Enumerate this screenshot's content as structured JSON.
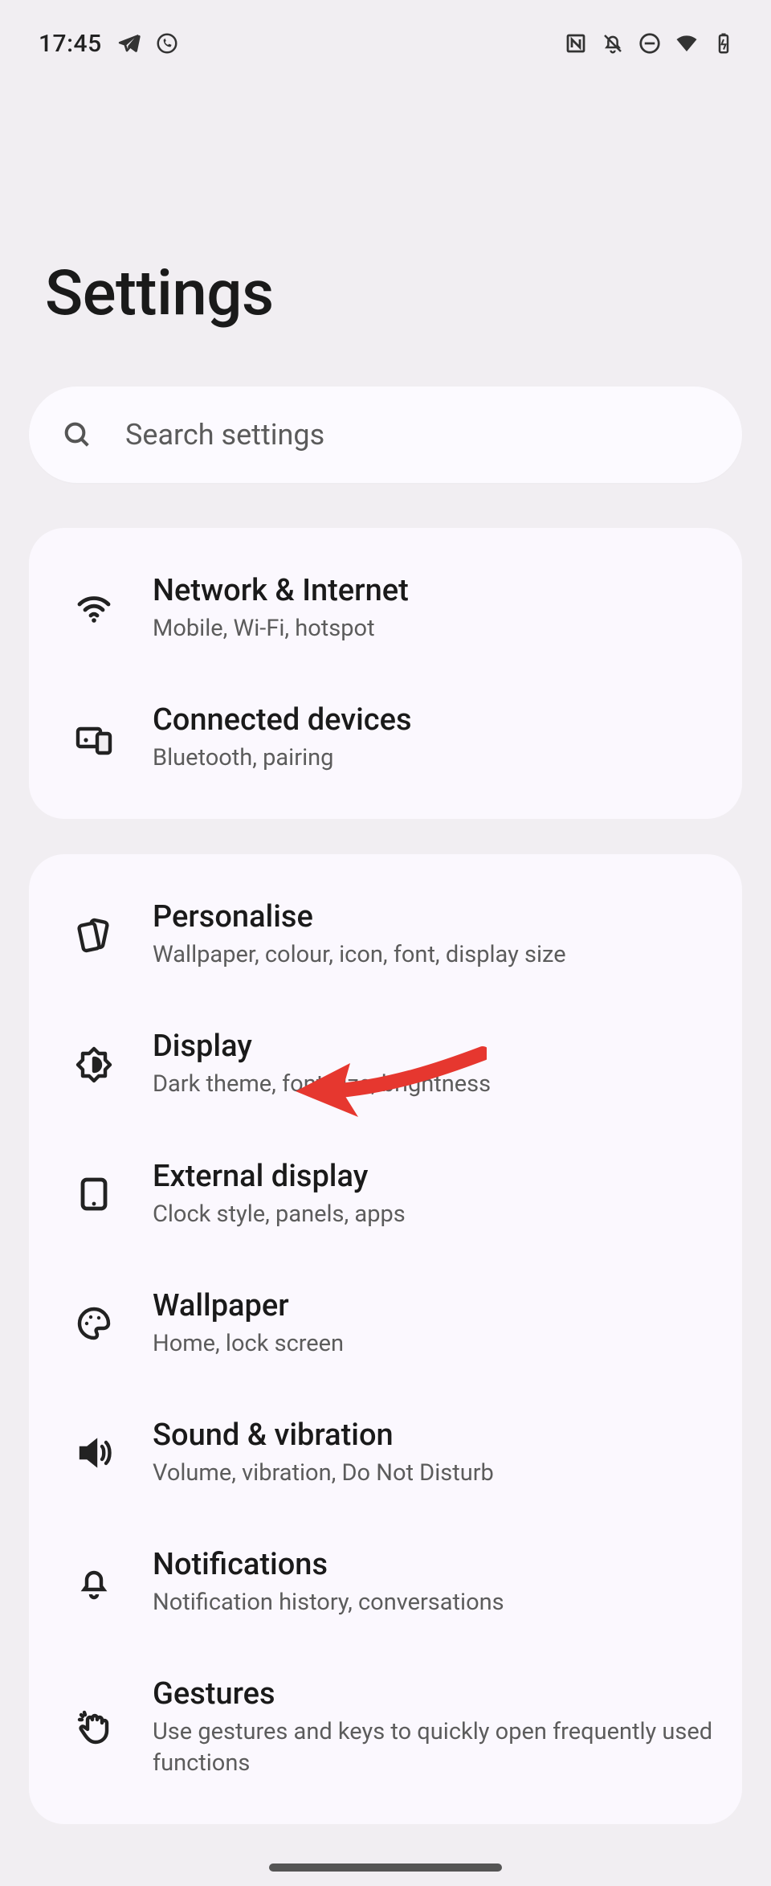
{
  "status": {
    "time": "17:45"
  },
  "header": {
    "title": "Settings"
  },
  "search": {
    "placeholder": "Search settings"
  },
  "groups": [
    {
      "items": [
        {
          "title": "Network & Internet",
          "subtitle": "Mobile, Wi-Fi, hotspot"
        },
        {
          "title": "Connected devices",
          "subtitle": "Bluetooth, pairing"
        }
      ]
    },
    {
      "items": [
        {
          "title": "Personalise",
          "subtitle": "Wallpaper, colour, icon, font, display size"
        },
        {
          "title": "Display",
          "subtitle": "Dark theme, font size, brightness"
        },
        {
          "title": "External display",
          "subtitle": "Clock style, panels, apps"
        },
        {
          "title": "Wallpaper",
          "subtitle": "Home, lock screen"
        },
        {
          "title": "Sound & vibration",
          "subtitle": "Volume, vibration, Do Not Disturb"
        },
        {
          "title": "Notifications",
          "subtitle": "Notification history, conversations"
        },
        {
          "title": "Gestures",
          "subtitle": "Use gestures and keys to quickly open frequently used functions"
        }
      ]
    }
  ],
  "annotation": {
    "arrow_target": "Display"
  }
}
